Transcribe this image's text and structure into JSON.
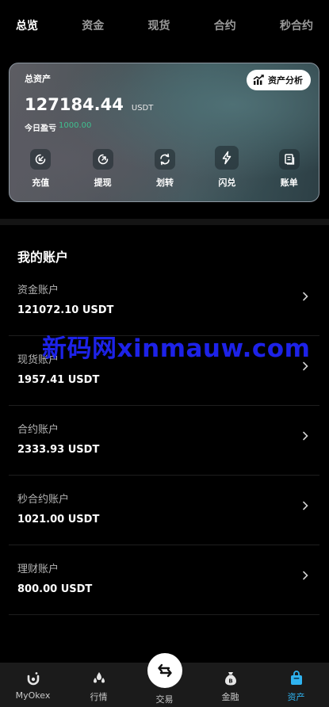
{
  "top_tabs": [
    {
      "label": "总览",
      "active": true
    },
    {
      "label": "资金",
      "active": false
    },
    {
      "label": "现货",
      "active": false
    },
    {
      "label": "合约",
      "active": false
    },
    {
      "label": "秒合约",
      "active": false
    }
  ],
  "asset_card": {
    "title": "总资产",
    "analysis_label": "资产分析",
    "total_value": "127184.44",
    "total_unit": "USDT",
    "pnl_label": "今日盈亏",
    "pnl_value": "1000.00",
    "actions": [
      {
        "label": "充值",
        "icon": "deposit-icon"
      },
      {
        "label": "提现",
        "icon": "withdraw-icon"
      },
      {
        "label": "划转",
        "icon": "transfer-icon"
      },
      {
        "label": "闪兑",
        "icon": "flash-exchange-icon"
      },
      {
        "label": "账单",
        "icon": "bill-icon"
      }
    ]
  },
  "accounts_section": {
    "title": "我的账户",
    "items": [
      {
        "name": "资金账户",
        "value": "121072.10 USDT"
      },
      {
        "name": "现货账户",
        "value": "1957.41 USDT"
      },
      {
        "name": "合约账户",
        "value": "2333.93 USDT"
      },
      {
        "name": "秒合约账户",
        "value": "1021.00 USDT"
      },
      {
        "name": "理财账户",
        "value": "800.00 USDT"
      }
    ]
  },
  "watermark": "新码网xinmauw.com",
  "bottom_nav": [
    {
      "label": "MyOkex",
      "icon": "myokex-icon",
      "active": false
    },
    {
      "label": "行情",
      "icon": "market-icon",
      "active": false
    },
    {
      "label": "交易",
      "icon": "trade-icon",
      "active": false
    },
    {
      "label": "金融",
      "icon": "finance-icon",
      "active": false
    },
    {
      "label": "资产",
      "icon": "assets-icon",
      "active": true
    }
  ],
  "colors": {
    "accent": "#2fb3f0",
    "profit": "#3fbf8f",
    "watermark": "#1d22e8"
  }
}
